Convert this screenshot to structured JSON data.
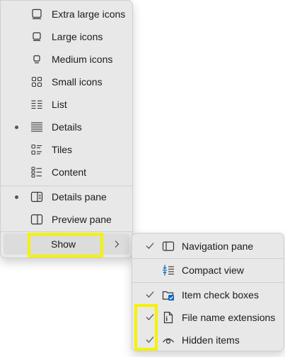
{
  "view_menu": {
    "items": [
      {
        "label": "Extra large icons",
        "icon": "extra-large-icons-icon",
        "selected": false
      },
      {
        "label": "Large icons",
        "icon": "large-icons-icon",
        "selected": false
      },
      {
        "label": "Medium icons",
        "icon": "medium-icons-icon",
        "selected": false
      },
      {
        "label": "Small icons",
        "icon": "small-icons-icon",
        "selected": false
      },
      {
        "label": "List",
        "icon": "list-icon",
        "selected": false
      },
      {
        "label": "Details",
        "icon": "details-icon",
        "selected": true
      },
      {
        "label": "Tiles",
        "icon": "tiles-icon",
        "selected": false
      },
      {
        "label": "Content",
        "icon": "content-icon",
        "selected": false
      }
    ],
    "panes": [
      {
        "label": "Details pane",
        "icon": "details-pane-icon",
        "selected": true
      },
      {
        "label": "Preview pane",
        "icon": "preview-pane-icon",
        "selected": false
      }
    ],
    "show": {
      "label": "Show",
      "icon": "chevron-right-icon"
    }
  },
  "show_submenu": {
    "items": [
      {
        "label": "Navigation pane",
        "icon": "navigation-pane-icon",
        "checked": true
      },
      {
        "label": "Compact view",
        "icon": "compact-view-icon",
        "checked": false
      },
      {
        "label": "Item check boxes",
        "icon": "item-check-boxes-icon",
        "checked": true
      },
      {
        "label": "File name extensions",
        "icon": "file-name-extensions-icon",
        "checked": true
      },
      {
        "label": "Hidden items",
        "icon": "hidden-items-icon",
        "checked": true
      }
    ]
  },
  "colors": {
    "menu_background": "#e8e8e8",
    "hover_background": "#dcdcdc",
    "highlight": "#f5f200",
    "accent": "#0067c0",
    "text": "#1b1b1b"
  }
}
